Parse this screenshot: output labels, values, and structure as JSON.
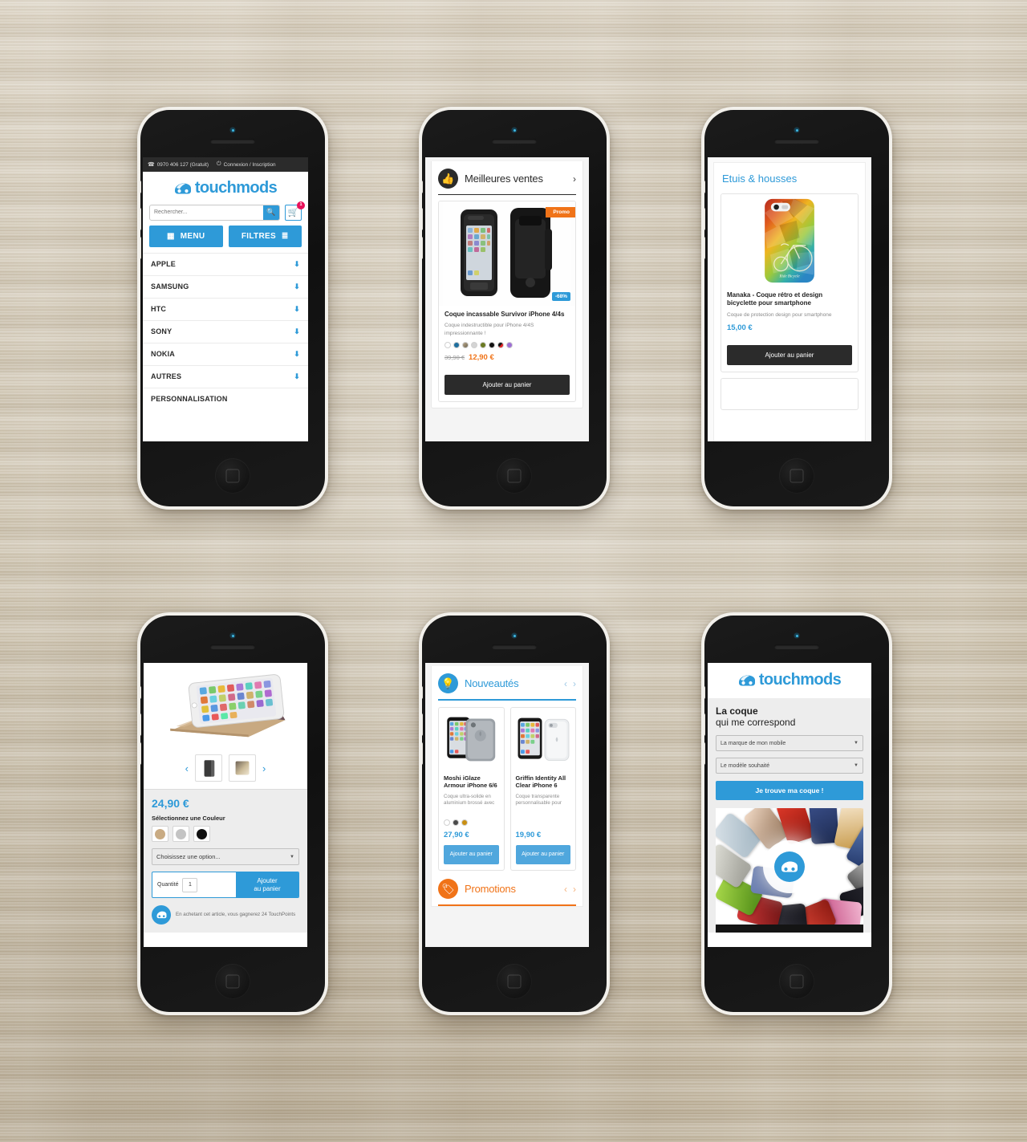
{
  "scene": {
    "background": "wood-desk",
    "phone_count": 6
  },
  "brand": {
    "name": "touchmods",
    "accent": "#2e9ad8",
    "orange": "#f07318",
    "dark": "#2b2b2b"
  },
  "phone1": {
    "topbar": {
      "phone": "0970 406 127 (Gratuit)",
      "phone_icon": "phone-icon",
      "account": "Connexion / Inscription",
      "account_icon": "power-icon"
    },
    "logo": "touchmods",
    "search": {
      "placeholder": "Rechercher...",
      "value": "",
      "icon": "search-icon"
    },
    "cart": {
      "icon": "cart-icon",
      "count": "1"
    },
    "buttons": [
      {
        "label": "MENU",
        "icon": "grid-icon"
      },
      {
        "label": "FILTRES",
        "icon": "list-icon"
      }
    ],
    "nav": [
      {
        "label": "APPLE",
        "arrow": "down-arrow-icon"
      },
      {
        "label": "SAMSUNG",
        "arrow": "down-arrow-icon"
      },
      {
        "label": "HTC",
        "arrow": "down-arrow-icon"
      },
      {
        "label": "SONY",
        "arrow": "down-arrow-icon"
      },
      {
        "label": "NOKIA",
        "arrow": "down-arrow-icon"
      },
      {
        "label": "AUTRES",
        "arrow": "down-arrow-icon"
      },
      {
        "label": "PERSONNALISATION",
        "arrow": ""
      }
    ]
  },
  "phone2": {
    "section": {
      "title": "Meilleures ventes",
      "icon": "thumbs-up-icon",
      "icon_bg": "#2b2b2b",
      "title_color": "#2b2b2b",
      "rule_color": "#2b2b2b",
      "next": "chevron-right-icon"
    },
    "product": {
      "ribbon": "Promo",
      "discount": "-68%",
      "title": "Coque incassable Survivor iPhone 4/4s",
      "desc": "Coque indestructible pour iPhone 4/4S impressionnante !",
      "colors": [
        "#ffffff",
        "#1f6f9e",
        "#9b8b74",
        "#d4d4d4",
        "#6b7a22",
        "#111111",
        "#111111",
        "#e02020",
        "#9d6fd4"
      ],
      "old_price": "39,90 €",
      "new_price": "12,90 €",
      "cta": "Ajouter au panier"
    }
  },
  "phone3": {
    "title": "Etuis & housses",
    "product": {
      "title": "Manaka - Coque rétro et design bicyclette pour smartphone",
      "desc": "Coque de protection design pour smartphone",
      "price": "15,00 €",
      "cta": "Ajouter au panier"
    }
  },
  "phone4": {
    "gallery": {
      "prev": "chevron-left-icon",
      "next": "chevron-right-icon",
      "thumbs": [
        "case-front-thumb",
        "case-back-thumb"
      ]
    },
    "price": "24,90 €",
    "color_label": "Sélectionnez une Couleur",
    "colors": [
      "#c9ab83",
      "#c4c4c4",
      "#111111"
    ],
    "option_select": {
      "value": "Choisissez une option...",
      "caret": "caret-down-icon"
    },
    "quantity": {
      "label": "Quantité",
      "value": "1"
    },
    "cta_line1": "Ajouter",
    "cta_line2": "au panier",
    "points": {
      "icon": "touchpoints-icon",
      "text": "En achetant cet article, vous gagnerez 24 TouchPoints"
    }
  },
  "phone5": {
    "section": {
      "title": "Nouveautés",
      "icon": "lightbulb-icon",
      "icon_bg": "#2e9ad8",
      "title_color": "#2e9ad8",
      "rule_color": "#2e9ad8",
      "prev": "chevron-left-icon",
      "next": "chevron-right-icon"
    },
    "products": [
      {
        "title": "Moshi iGlaze Armour iPhone 6/6",
        "desc": "Coque ultra-solide en aluminium brossé avec",
        "colors": [
          "#ffffff",
          "#4a4a4a",
          "#c98f12"
        ],
        "price": "27,90 €",
        "cta": "Ajouter au panier"
      },
      {
        "title": "Griffin Identity All Clear iPhone 6",
        "desc": "Coque transparente personnalisable pour",
        "colors": [],
        "price": "19,90 €",
        "cta": "Ajouter au panier"
      }
    ],
    "section2": {
      "title": "Promotions",
      "icon": "tag-icon",
      "icon_bg": "#f07318",
      "title_color": "#f07318",
      "rule_color": "#f07318",
      "prev": "chevron-left-icon",
      "next": "chevron-right-icon"
    }
  },
  "phone6": {
    "logo": "touchmods",
    "heading_bold": "La coque",
    "heading_light": "qui me correspond",
    "selects": [
      {
        "value": "La marque de mon mobile",
        "caret": "caret-down-icon"
      },
      {
        "value": "Le modèle souhaité",
        "caret": "caret-down-icon"
      }
    ],
    "cta": "Je trouve ma coque !",
    "collage": {
      "hub_icon": "touchmods-mark-icon"
    }
  }
}
